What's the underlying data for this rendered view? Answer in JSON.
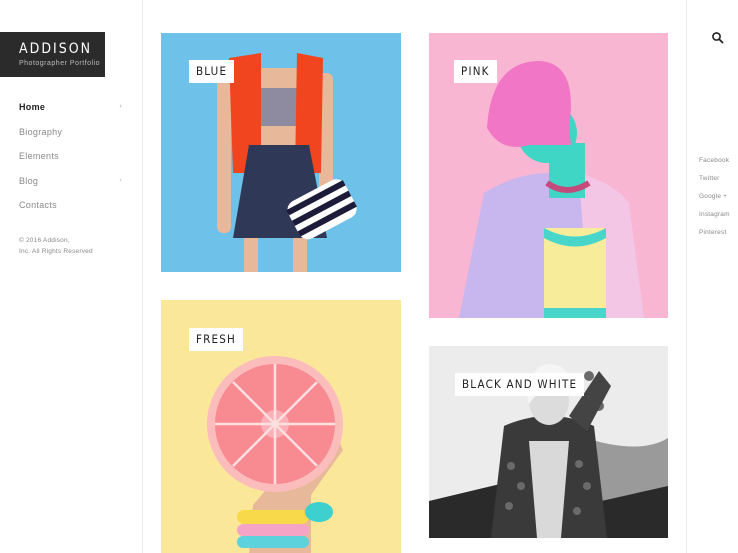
{
  "brand": {
    "title": "ADDISON",
    "subtitle": "Photographer Portfolio"
  },
  "nav": {
    "items": [
      {
        "label": "Home",
        "has_submenu": true,
        "active": true
      },
      {
        "label": "Biography",
        "has_submenu": false,
        "active": false
      },
      {
        "label": "Elements",
        "has_submenu": false,
        "active": false
      },
      {
        "label": "Blog",
        "has_submenu": true,
        "active": false
      },
      {
        "label": "Contacts",
        "has_submenu": false,
        "active": false
      }
    ],
    "submenu_arrow": "›"
  },
  "footer": {
    "line1": "© 2016 Addison,",
    "line2": "Inc. All Rights Reserved"
  },
  "social": {
    "items": [
      "Facebook",
      "Twitter",
      "Google +",
      "Instagram",
      "Pinterest"
    ]
  },
  "header": {
    "search_icon": "search-icon"
  },
  "gallery": {
    "tiles": [
      {
        "label": "BLUE",
        "background": "#6ec1e9"
      },
      {
        "label": "PINK",
        "background": "#f9b6d2"
      },
      {
        "label": "FRESH",
        "background": "#fbe79a"
      },
      {
        "label": "BLACK AND WHITE",
        "background": "#e2e2e2"
      }
    ]
  },
  "colors": {
    "logo_bg": "#2b2b2b",
    "text_muted": "#8a8a8a",
    "text_dark": "#222222"
  }
}
